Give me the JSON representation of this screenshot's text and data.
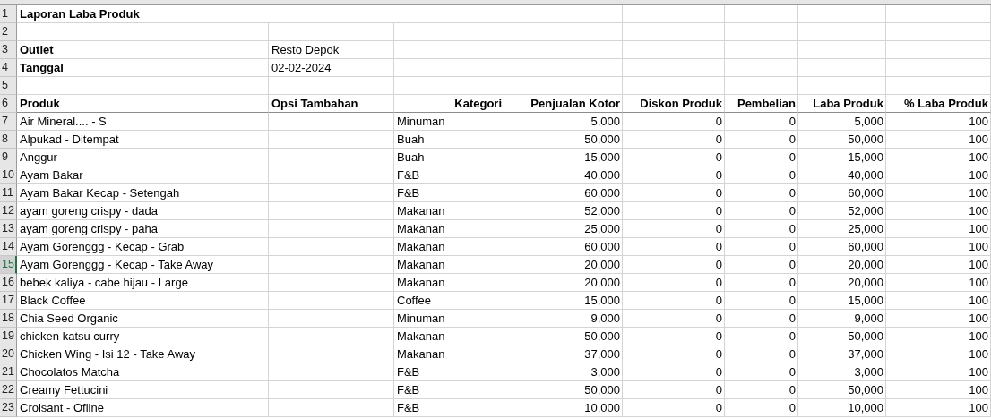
{
  "title": "Laporan Laba Produk",
  "info": [
    {
      "label": "Outlet",
      "value": "Resto Depok"
    },
    {
      "label": "Tanggal",
      "value": "02-02-2024"
    }
  ],
  "columns": [
    "Produk",
    "Opsi Tambahan",
    "Kategori",
    "Penjualan Kotor",
    "Diskon Produk",
    "Pembelian",
    "Laba Produk",
    "% Laba Produk"
  ],
  "row_numbers": [
    {
      "label": "1",
      "selected": false
    },
    {
      "label": "2",
      "selected": false
    },
    {
      "label": "3",
      "selected": false
    },
    {
      "label": "4",
      "selected": false
    },
    {
      "label": "5",
      "selected": false
    },
    {
      "label": "6",
      "selected": false
    },
    {
      "label": "7",
      "selected": false
    },
    {
      "label": "8",
      "selected": false
    },
    {
      "label": "9",
      "selected": false
    },
    {
      "label": "10",
      "selected": false
    },
    {
      "label": "11",
      "selected": false
    },
    {
      "label": "12",
      "selected": false
    },
    {
      "label": "13",
      "selected": false
    },
    {
      "label": "14",
      "selected": false
    },
    {
      "label": "15",
      "selected": true
    },
    {
      "label": "16",
      "selected": false
    },
    {
      "label": "17",
      "selected": false
    },
    {
      "label": "18",
      "selected": false
    },
    {
      "label": "19",
      "selected": false
    },
    {
      "label": "20",
      "selected": false
    },
    {
      "label": "21",
      "selected": false
    },
    {
      "label": "22",
      "selected": false
    },
    {
      "label": "23",
      "selected": false
    }
  ],
  "rows": [
    [
      "Air Mineral.... - S",
      "Minuman",
      "5,000",
      "0",
      "0",
      "5,000",
      "100"
    ],
    [
      "Alpukad - Ditempat",
      "Buah",
      "50,000",
      "0",
      "0",
      "50,000",
      "100"
    ],
    [
      "Anggur",
      "Buah",
      "15,000",
      "0",
      "0",
      "15,000",
      "100"
    ],
    [
      "Ayam Bakar",
      "F&B",
      "40,000",
      "0",
      "0",
      "40,000",
      "100"
    ],
    [
      "Ayam Bakar Kecap - Setengah",
      "F&B",
      "60,000",
      "0",
      "0",
      "60,000",
      "100"
    ],
    [
      "ayam goreng crispy - dada",
      "Makanan",
      "52,000",
      "0",
      "0",
      "52,000",
      "100"
    ],
    [
      "ayam goreng crispy - paha",
      "Makanan",
      "25,000",
      "0",
      "0",
      "25,000",
      "100"
    ],
    [
      "Ayam Gorenggg - Kecap - Grab",
      "Makanan",
      "60,000",
      "0",
      "0",
      "60,000",
      "100"
    ],
    [
      "Ayam Gorenggg - Kecap - Take Away",
      "Makanan",
      "20,000",
      "0",
      "0",
      "20,000",
      "100"
    ],
    [
      "bebek kaliya - cabe hijau - Large",
      "Makanan",
      "20,000",
      "0",
      "0",
      "20,000",
      "100"
    ],
    [
      "Black Coffee",
      "Coffee",
      "15,000",
      "0",
      "0",
      "15,000",
      "100"
    ],
    [
      "Chia Seed Organic",
      "Minuman",
      "9,000",
      "0",
      "0",
      "9,000",
      "100"
    ],
    [
      "chicken katsu curry",
      "Makanan",
      "50,000",
      "0",
      "0",
      "50,000",
      "100"
    ],
    [
      "Chicken Wing - Isi 12 - Take Away",
      "Makanan",
      "37,000",
      "0",
      "0",
      "37,000",
      "100"
    ],
    [
      "Chocolatos Matcha",
      "F&B",
      "3,000",
      "0",
      "0",
      "3,000",
      "100"
    ],
    [
      "Creamy Fettucini",
      "F&B",
      "50,000",
      "0",
      "0",
      "50,000",
      "100"
    ],
    [
      "Croisant - Ofline",
      "F&B",
      "10,000",
      "0",
      "0",
      "10,000",
      "100"
    ]
  ]
}
